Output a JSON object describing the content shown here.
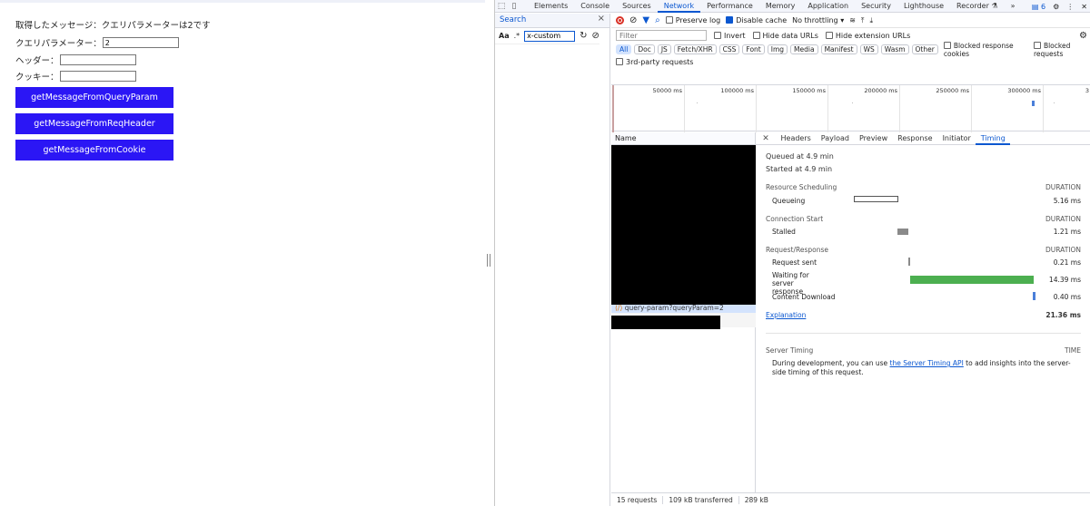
{
  "page": {
    "message": "取得したメッセージ：クエリパラメーターは2です",
    "query_label": "クエリパラメーター：",
    "query_value": "2",
    "header_label": "ヘッダー：",
    "header_value": "",
    "cookie_label": "クッキー：",
    "cookie_value": "",
    "buttons": [
      "getMessageFromQueryParam",
      "getMessageFromReqHeader",
      "getMessageFromCookie"
    ]
  },
  "devtools": {
    "tabs": [
      "Elements",
      "Console",
      "Sources",
      "Network",
      "Performance",
      "Memory",
      "Application",
      "Security",
      "Lighthouse",
      "Recorder"
    ],
    "active_tab": "Network",
    "more": "»",
    "issues_count": "6",
    "search": {
      "title": "Search",
      "aa": "Aa",
      "regex": ".*",
      "query": "x-custom"
    },
    "network": {
      "preserve_log": "Preserve log",
      "disable_cache": "Disable cache",
      "throttling": "No throttling",
      "filter_placeholder": "Filter",
      "invert": "Invert",
      "hide_data_urls": "Hide data URLs",
      "hide_extension_urls": "Hide extension URLs",
      "types": [
        "All",
        "Doc",
        "JS",
        "Fetch/XHR",
        "CSS",
        "Font",
        "Img",
        "Media",
        "Manifest",
        "WS",
        "Wasm",
        "Other"
      ],
      "blocked_cookies": "Blocked response cookies",
      "blocked_requests": "Blocked requests",
      "third_party": "3rd-party requests",
      "ticks": [
        "50000 ms",
        "100000 ms",
        "150000 ms",
        "200000 ms",
        "250000 ms",
        "300000 ms",
        "3"
      ],
      "name_header": "Name",
      "selected_request": "query-param?queryParam=2",
      "status": {
        "requests": "15 requests",
        "transferred": "109 kB transferred",
        "resources": "289 kB"
      }
    },
    "detail": {
      "tabs": [
        "Headers",
        "Payload",
        "Preview",
        "Response",
        "Initiator",
        "Timing"
      ],
      "active_tab": "Timing",
      "queued": "Queued at 4.9 min",
      "started": "Started at 4.9 min",
      "sections": {
        "resource_scheduling": "Resource Scheduling",
        "connection_start": "Connection Start",
        "request_response": "Request/Response",
        "duration": "DURATION"
      },
      "rows": {
        "queueing": {
          "label": "Queueing",
          "value": "5.16 ms"
        },
        "stalled": {
          "label": "Stalled",
          "value": "1.21 ms"
        },
        "request_sent": {
          "label": "Request sent",
          "value": "0.21 ms"
        },
        "waiting": {
          "label": "Waiting for server response",
          "value": "14.39 ms"
        },
        "content_download": {
          "label": "Content Download",
          "value": "0.40 ms"
        }
      },
      "explanation": "Explanation",
      "total": "21.36 ms",
      "server_timing": "Server Timing",
      "time": "TIME",
      "server_text_pre": "During development, you can use ",
      "server_link": "the Server Timing API",
      "server_text_post": " to add insights into the server-side timing of this request."
    },
    "colors": {
      "accent": "#0b57d0",
      "button": "#2b16f5",
      "waiting_bar": "#4caf50",
      "download_bar": "#4a7fd9",
      "stalled_bar": "#8a8a8a"
    }
  }
}
